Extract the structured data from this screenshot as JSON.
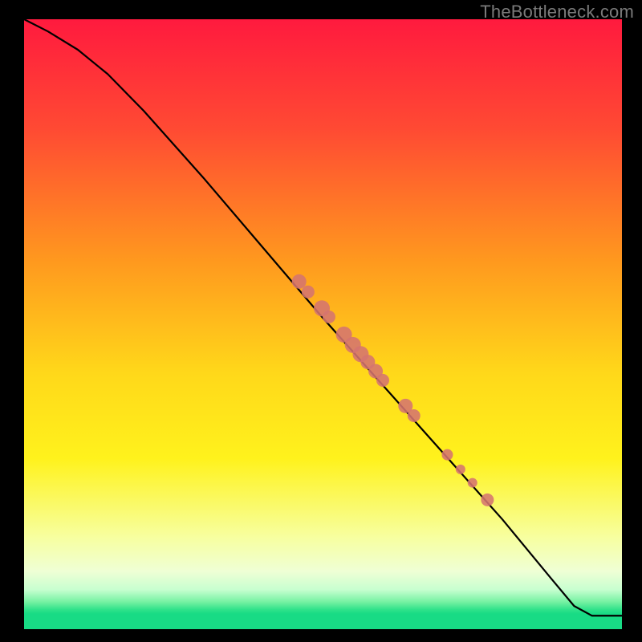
{
  "watermark": "TheBottleneck.com",
  "colors": {
    "frame": "#000000",
    "curve": "#000000",
    "marker_fill": "#d5746f",
    "marker_stroke": "#b45b57"
  },
  "plot": {
    "inner_x": 30,
    "inner_y": 24,
    "inner_w": 745,
    "inner_h": 760
  },
  "chart_data": {
    "type": "line",
    "title": "",
    "xlabel": "",
    "ylabel": "",
    "xlim": [
      0,
      100
    ],
    "ylim": [
      0,
      100
    ],
    "gradient_stops": [
      {
        "offset": 0.0,
        "color": "#ff1a3e"
      },
      {
        "offset": 0.18,
        "color": "#ff4a33"
      },
      {
        "offset": 0.4,
        "color": "#ff9a1e"
      },
      {
        "offset": 0.58,
        "color": "#ffd81a"
      },
      {
        "offset": 0.72,
        "color": "#fff21c"
      },
      {
        "offset": 0.85,
        "color": "#f7ffa0"
      },
      {
        "offset": 0.905,
        "color": "#efffd5"
      },
      {
        "offset": 0.935,
        "color": "#c8ffd0"
      },
      {
        "offset": 0.955,
        "color": "#77f2a3"
      },
      {
        "offset": 0.968,
        "color": "#2fe28a"
      },
      {
        "offset": 0.975,
        "color": "#18db85"
      },
      {
        "offset": 1.0,
        "color": "#18db85"
      }
    ],
    "series": [
      {
        "name": "curve",
        "x": [
          0,
          4,
          9,
          14,
          20,
          30,
          40,
          50,
          60,
          70,
          80,
          88,
          92,
          95,
          100
        ],
        "y": [
          100,
          98,
          95,
          91,
          85,
          74,
          62.5,
          51,
          40,
          29,
          18,
          8.5,
          3.8,
          2.2,
          2.2
        ]
      }
    ],
    "markers": {
      "name": "highlighted-points",
      "points": [
        {
          "x": 46.0,
          "y": 57.0,
          "r": 9
        },
        {
          "x": 47.5,
          "y": 55.3,
          "r": 8
        },
        {
          "x": 49.8,
          "y": 52.6,
          "r": 10
        },
        {
          "x": 51.0,
          "y": 51.2,
          "r": 8
        },
        {
          "x": 53.5,
          "y": 48.3,
          "r": 10
        },
        {
          "x": 55.0,
          "y": 46.6,
          "r": 10
        },
        {
          "x": 56.3,
          "y": 45.1,
          "r": 10
        },
        {
          "x": 57.5,
          "y": 43.8,
          "r": 9
        },
        {
          "x": 58.8,
          "y": 42.3,
          "r": 9
        },
        {
          "x": 60.0,
          "y": 40.8,
          "r": 8
        },
        {
          "x": 63.8,
          "y": 36.6,
          "r": 9
        },
        {
          "x": 65.2,
          "y": 35.0,
          "r": 8
        },
        {
          "x": 70.8,
          "y": 28.6,
          "r": 7
        },
        {
          "x": 73.0,
          "y": 26.2,
          "r": 6
        },
        {
          "x": 75.0,
          "y": 24.0,
          "r": 6
        },
        {
          "x": 77.5,
          "y": 21.2,
          "r": 8
        }
      ]
    }
  }
}
